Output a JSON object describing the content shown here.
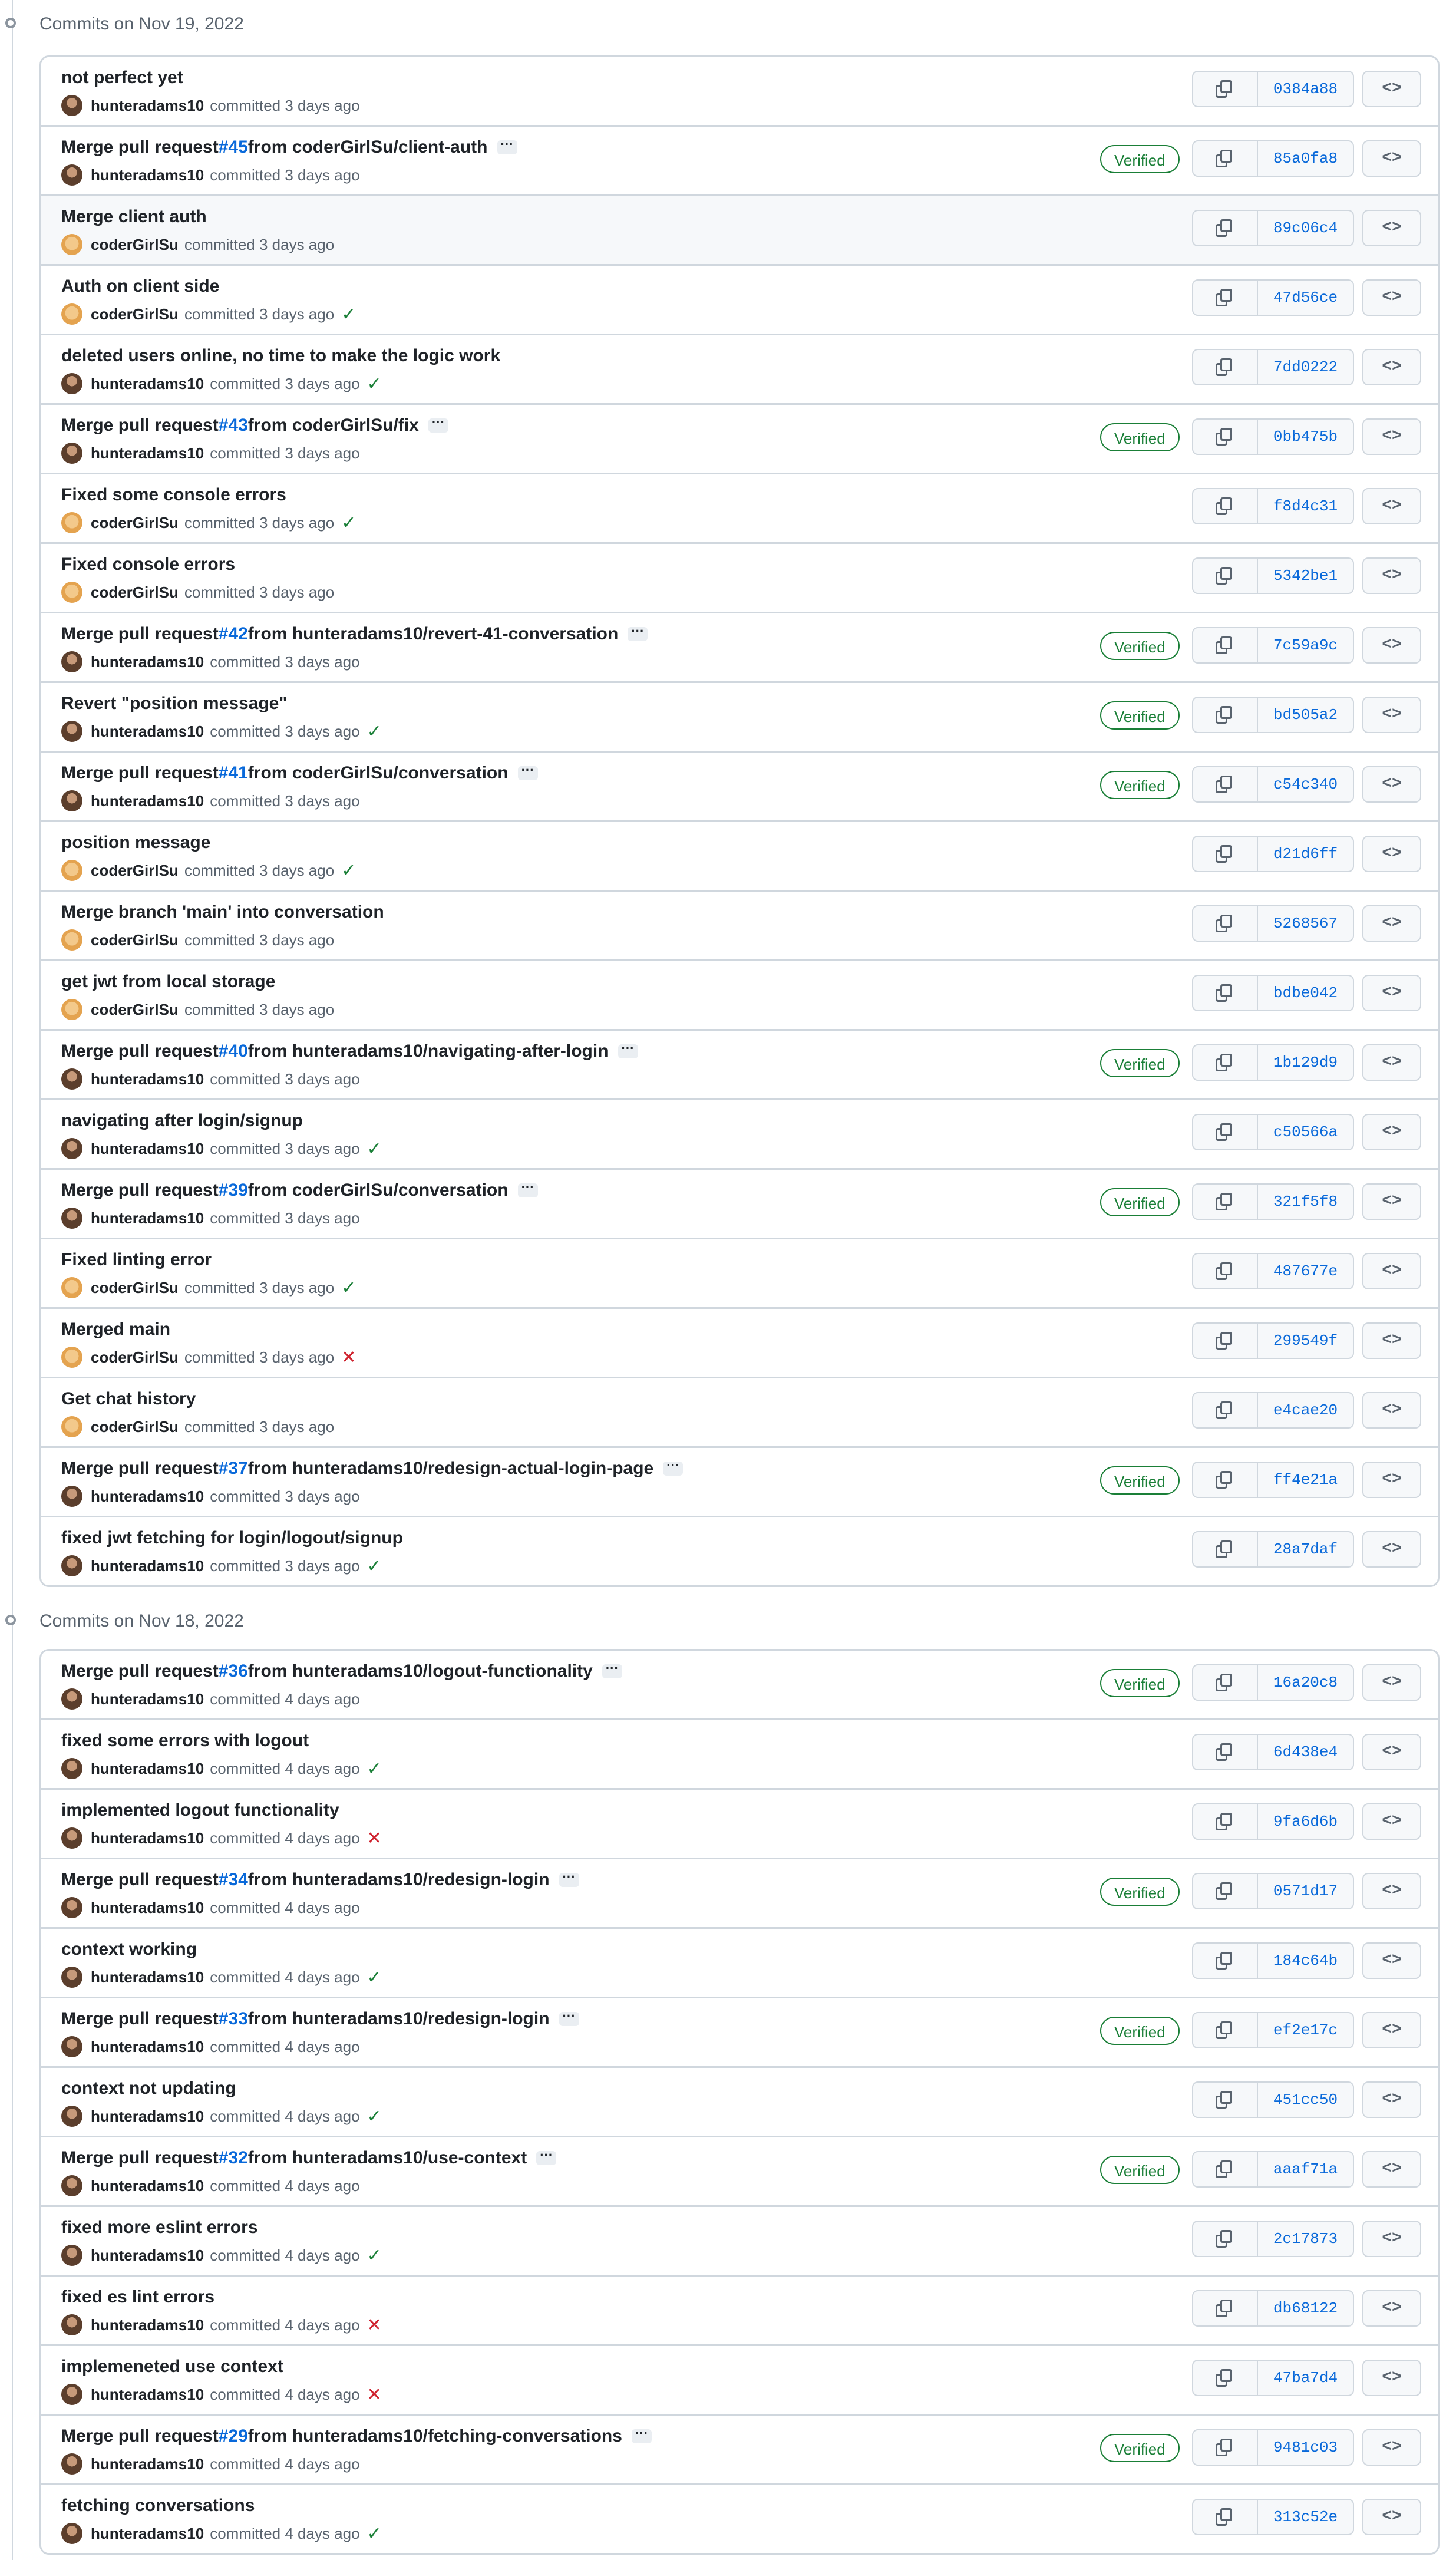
{
  "groups": [
    {
      "title": "Commits on Nov 19, 2022",
      "commits": [
        {
          "message": "not perfect yet",
          "author": "hunteradams10",
          "time": "committed 3 days ago",
          "status": "",
          "sha": "0384a88",
          "verified": ""
        },
        {
          "message": "Merge pull request ",
          "pr": "#45",
          "from": " from coderGirlSu/client-auth",
          "author": "hunteradams10",
          "time": "committed 3 days ago",
          "status": "",
          "sha": "85a0fa8",
          "verified": "Verified",
          "more": "···"
        },
        {
          "message": "Merge client auth",
          "author": "coderGirlSu",
          "time": "committed 3 days ago",
          "status": "",
          "sha": "89c06c4",
          "verified": "",
          "highlight": true
        },
        {
          "message": "Auth on client side",
          "author": "coderGirlSu",
          "time": "committed 3 days ago",
          "status": "ok",
          "sha": "47d56ce",
          "verified": ""
        },
        {
          "message": "deleted users online, no time to make the logic work",
          "author": "hunteradams10",
          "time": "committed 3 days ago",
          "status": "ok",
          "sha": "7dd0222",
          "verified": ""
        },
        {
          "message": "Merge pull request ",
          "pr": "#43",
          "from": " from coderGirlSu/fix",
          "author": "hunteradams10",
          "time": "committed 3 days ago",
          "status": "",
          "sha": "0bb475b",
          "verified": "Verified",
          "more": "···"
        },
        {
          "message": "Fixed some console errors",
          "author": "coderGirlSu",
          "time": "committed 3 days ago",
          "status": "ok",
          "sha": "f8d4c31",
          "verified": ""
        },
        {
          "message": "Fixed console errors",
          "author": "coderGirlSu",
          "time": "committed 3 days ago",
          "status": "",
          "sha": "5342be1",
          "verified": ""
        },
        {
          "message": "Merge pull request ",
          "pr": "#42",
          "from": " from hunteradams10/revert-41-conversation",
          "author": "hunteradams10",
          "time": "committed 3 days ago",
          "status": "",
          "sha": "7c59a9c",
          "verified": "Verified",
          "more": "···"
        },
        {
          "message": "Revert \"position message\"",
          "author": "hunteradams10",
          "time": "committed 3 days ago",
          "status": "ok",
          "sha": "bd505a2",
          "verified": "Verified"
        },
        {
          "message": "Merge pull request ",
          "pr": "#41",
          "from": " from coderGirlSu/conversation",
          "author": "hunteradams10",
          "time": "committed 3 days ago",
          "status": "",
          "sha": "c54c340",
          "verified": "Verified",
          "more": "···"
        },
        {
          "message": "position message",
          "author": "coderGirlSu",
          "time": "committed 3 days ago",
          "status": "ok",
          "sha": "d21d6ff",
          "verified": ""
        },
        {
          "message": "Merge branch 'main' into conversation",
          "author": "coderGirlSu",
          "time": "committed 3 days ago",
          "status": "",
          "sha": "5268567",
          "verified": ""
        },
        {
          "message": "get jwt from local storage",
          "author": "coderGirlSu",
          "time": "committed 3 days ago",
          "status": "",
          "sha": "bdbe042",
          "verified": ""
        },
        {
          "message": "Merge pull request ",
          "pr": "#40",
          "from": " from hunteradams10/navigating-after-login",
          "author": "hunteradams10",
          "time": "committed 3 days ago",
          "status": "",
          "sha": "1b129d9",
          "verified": "Verified",
          "more": "···"
        },
        {
          "message": "navigating after login/signup",
          "author": "hunteradams10",
          "time": "committed 3 days ago",
          "status": "ok",
          "sha": "c50566a",
          "verified": ""
        },
        {
          "message": "Merge pull request ",
          "pr": "#39",
          "from": " from coderGirlSu/conversation",
          "author": "hunteradams10",
          "time": "committed 3 days ago",
          "status": "",
          "sha": "321f5f8",
          "verified": "Verified",
          "more": "···"
        },
        {
          "message": "Fixed linting error",
          "author": "coderGirlSu",
          "time": "committed 3 days ago",
          "status": "ok",
          "sha": "487677e",
          "verified": ""
        },
        {
          "message": "Merged main",
          "author": "coderGirlSu",
          "time": "committed 3 days ago",
          "status": "fail",
          "sha": "299549f",
          "verified": ""
        },
        {
          "message": "Get chat history",
          "author": "coderGirlSu",
          "time": "committed 3 days ago",
          "status": "",
          "sha": "e4cae20",
          "verified": ""
        },
        {
          "message": "Merge pull request ",
          "pr": "#37",
          "from": " from hunteradams10/redesign-actual-login-page",
          "author": "hunteradams10",
          "time": "committed 3 days ago",
          "status": "",
          "sha": "ff4e21a",
          "verified": "Verified",
          "more": "···"
        },
        {
          "message": "fixed jwt fetching for login/logout/signup",
          "author": "hunteradams10",
          "time": "committed 3 days ago",
          "status": "ok",
          "sha": "28a7daf",
          "verified": ""
        }
      ]
    },
    {
      "title": "Commits on Nov 18, 2022",
      "commits": [
        {
          "message": "Merge pull request ",
          "pr": "#36",
          "from": " from hunteradams10/logout-functionality",
          "author": "hunteradams10",
          "time": "committed 4 days ago",
          "status": "",
          "sha": "16a20c8",
          "verified": "Verified",
          "more": "···"
        },
        {
          "message": "fixed some errors with logout",
          "author": "hunteradams10",
          "time": "committed 4 days ago",
          "status": "ok",
          "sha": "6d438e4",
          "verified": ""
        },
        {
          "message": "implemented logout functionality",
          "author": "hunteradams10",
          "time": "committed 4 days ago",
          "status": "fail",
          "sha": "9fa6d6b",
          "verified": ""
        },
        {
          "message": "Merge pull request ",
          "pr": "#34",
          "from": " from hunteradams10/redesign-login",
          "author": "hunteradams10",
          "time": "committed 4 days ago",
          "status": "",
          "sha": "0571d17",
          "verified": "Verified",
          "more": "···"
        },
        {
          "message": "context working",
          "author": "hunteradams10",
          "time": "committed 4 days ago",
          "status": "ok",
          "sha": "184c64b",
          "verified": ""
        },
        {
          "message": "Merge pull request ",
          "pr": "#33",
          "from": " from hunteradams10/redesign-login",
          "author": "hunteradams10",
          "time": "committed 4 days ago",
          "status": "",
          "sha": "ef2e17c",
          "verified": "Verified",
          "more": "···"
        },
        {
          "message": "context not updating",
          "author": "hunteradams10",
          "time": "committed 4 days ago",
          "status": "ok",
          "sha": "451cc50",
          "verified": ""
        },
        {
          "message": "Merge pull request ",
          "pr": "#32",
          "from": " from hunteradams10/use-context",
          "author": "hunteradams10",
          "time": "committed 4 days ago",
          "status": "",
          "sha": "aaaf71a",
          "verified": "Verified",
          "more": "···"
        },
        {
          "message": "fixed more eslint errors",
          "author": "hunteradams10",
          "time": "committed 4 days ago",
          "status": "ok",
          "sha": "2c17873",
          "verified": ""
        },
        {
          "message": "fixed es lint errors",
          "author": "hunteradams10",
          "time": "committed 4 days ago",
          "status": "fail",
          "sha": "db68122",
          "verified": ""
        },
        {
          "message": "implemeneted use context",
          "author": "hunteradams10",
          "time": "committed 4 days ago",
          "status": "fail",
          "sha": "47ba7d4",
          "verified": ""
        },
        {
          "message": "Merge pull request ",
          "pr": "#29",
          "from": " from hunteradams10/fetching-conversations",
          "author": "hunteradams10",
          "time": "committed 4 days ago",
          "status": "",
          "sha": "9481c03",
          "verified": "Verified",
          "more": "···"
        },
        {
          "message": "fetching conversations",
          "author": "hunteradams10",
          "time": "committed 4 days ago",
          "status": "ok",
          "sha": "313c52e",
          "verified": ""
        }
      ]
    }
  ],
  "icons": {
    "status_ok": "✓",
    "status_fail": "✕",
    "browse": "<>"
  },
  "colors": {
    "link": "#0969da",
    "success": "#1a7f37",
    "danger": "#cf222e",
    "border": "#d0d7de"
  }
}
